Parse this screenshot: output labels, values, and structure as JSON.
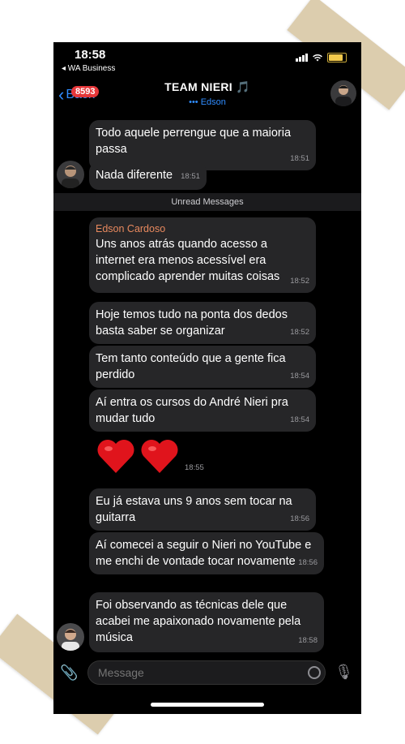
{
  "status": {
    "time": "18:58",
    "carrier": "◂ WA Business"
  },
  "header": {
    "back_label": "Back",
    "badge_count": "8593",
    "title": "TEAM NIERI 🎵",
    "subtitle": "••• Edson"
  },
  "messages": [
    {
      "text": "Todo aquele perrengue que a maioria passa",
      "time": "18:51"
    },
    {
      "text": "Nada diferente",
      "time": "18:51"
    },
    {
      "sender": "Edson Cardoso",
      "text": "Uns anos atrás quando acesso a internet era menos acessível era complicado aprender muitas coisas",
      "time": "18:52"
    },
    {
      "text": "Hoje temos tudo na ponta dos dedos basta saber se organizar",
      "time": "18:52"
    },
    {
      "text": "Tem tanto conteúdo que a gente fica perdido",
      "time": "18:54"
    },
    {
      "text": "Aí entra os cursos do André Nieri pra mudar tudo",
      "time": "18:54"
    },
    {
      "text": "❤️❤️",
      "time": "18:55"
    },
    {
      "text": "Eu já estava uns 9 anos sem tocar na guitarra",
      "time": "18:56"
    },
    {
      "text": "Aí comecei a seguir o Nieri no YouTube e me enchi de vontade tocar novamente",
      "time": "18:56"
    },
    {
      "text": "Foi observando as técnicas dele que acabei me apaixonado novamente pela música",
      "time": "18:58"
    }
  ],
  "divider_label": "Unread Messages",
  "input": {
    "placeholder": "Message"
  },
  "colors": {
    "accent": "#2f8cff",
    "sender": "#e8895e",
    "badge": "#e5373a",
    "bubble": "#262628"
  }
}
